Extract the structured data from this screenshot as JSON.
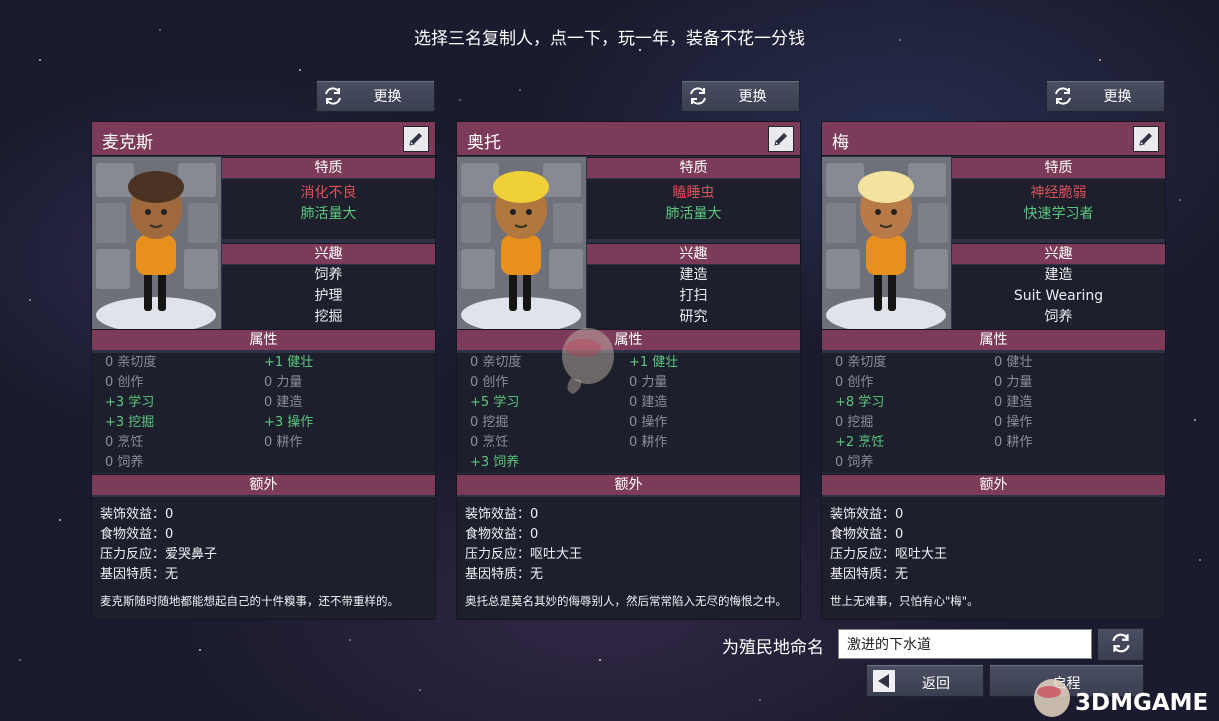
{
  "header": {
    "title": "选择三名复制人，点一下，玩一年，装备不花一分钱"
  },
  "reroll_label": "更换",
  "section_labels": {
    "traits": "特质",
    "interests": "兴趣",
    "attributes": "属性",
    "extra": "额外"
  },
  "cards": [
    {
      "name": "麦克斯",
      "traits": [
        {
          "text": "消化不良",
          "kind": "bad"
        },
        {
          "text": "肺活量大",
          "kind": "good"
        }
      ],
      "interests": [
        "饲养",
        "护理",
        "挖掘"
      ],
      "attributes": {
        "left": [
          {
            "text": "0 亲切度",
            "kind": "zero"
          },
          {
            "text": "0 创作",
            "kind": "zero"
          },
          {
            "text": "+3 学习",
            "kind": "pos"
          },
          {
            "text": "+3 挖掘",
            "kind": "pos"
          },
          {
            "text": "0 烹饪",
            "kind": "zero"
          },
          {
            "text": "0 饲养",
            "kind": "zero"
          }
        ],
        "right": [
          {
            "text": "+1 健壮",
            "kind": "pos"
          },
          {
            "text": "0 力量",
            "kind": "zero"
          },
          {
            "text": "0 建造",
            "kind": "zero"
          },
          {
            "text": "+3 操作",
            "kind": "pos"
          },
          {
            "text": "0 耕作",
            "kind": "zero"
          }
        ]
      },
      "extra": {
        "decor": "装饰效益：0",
        "food": "食物效益：0",
        "stress": "压力反应：爱哭鼻子",
        "gene": "基因特质：无"
      },
      "bio": "麦克斯随时随地都能想起自己的十件糗事，还不带重样的。",
      "hair_color": "#4a3322",
      "skin_color": "#a06a3e",
      "suit_color": "#e8901e"
    },
    {
      "name": "奥托",
      "traits": [
        {
          "text": "瞌睡虫",
          "kind": "bad"
        },
        {
          "text": "肺活量大",
          "kind": "good"
        }
      ],
      "interests": [
        "建造",
        "打扫",
        "研究"
      ],
      "attributes": {
        "left": [
          {
            "text": "0 亲切度",
            "kind": "zero"
          },
          {
            "text": "0 创作",
            "kind": "zero"
          },
          {
            "text": "+5 学习",
            "kind": "pos"
          },
          {
            "text": "0 挖掘",
            "kind": "zero"
          },
          {
            "text": "0 烹饪",
            "kind": "zero"
          },
          {
            "text": "+3 饲养",
            "kind": "pos"
          }
        ],
        "right": [
          {
            "text": "+1 健壮",
            "kind": "pos"
          },
          {
            "text": "0 力量",
            "kind": "zero"
          },
          {
            "text": "0 建造",
            "kind": "zero"
          },
          {
            "text": "0 操作",
            "kind": "zero"
          },
          {
            "text": "0 耕作",
            "kind": "zero"
          }
        ]
      },
      "extra": {
        "decor": "装饰效益：0",
        "food": "食物效益：0",
        "stress": "压力反应：呕吐大王",
        "gene": "基因特质：无"
      },
      "bio": "奥托总是莫名其妙的侮辱别人，然后常常陷入无尽的悔恨之中。",
      "hair_color": "#f0d038",
      "skin_color": "#b0783e",
      "suit_color": "#e8901e"
    },
    {
      "name": "梅",
      "traits": [
        {
          "text": "神经脆弱",
          "kind": "bad"
        },
        {
          "text": "快速学习者",
          "kind": "good"
        }
      ],
      "interests": [
        "建造",
        "Suit Wearing",
        "饲养"
      ],
      "attributes": {
        "left": [
          {
            "text": "0 亲切度",
            "kind": "zero"
          },
          {
            "text": "0 创作",
            "kind": "zero"
          },
          {
            "text": "+8 学习",
            "kind": "pos"
          },
          {
            "text": "0 挖掘",
            "kind": "zero"
          },
          {
            "text": "+2 烹饪",
            "kind": "pos"
          },
          {
            "text": "0 饲养",
            "kind": "zero"
          }
        ],
        "right": [
          {
            "text": "0 健壮",
            "kind": "zero"
          },
          {
            "text": "0 力量",
            "kind": "zero"
          },
          {
            "text": "0 建造",
            "kind": "zero"
          },
          {
            "text": "0 操作",
            "kind": "zero"
          },
          {
            "text": "0 耕作",
            "kind": "zero"
          }
        ]
      },
      "extra": {
        "decor": "装饰效益：0",
        "food": "食物效益：0",
        "stress": "压力反应：呕吐大王",
        "gene": "基因特质：无"
      },
      "bio": "世上无难事，只怕有心\"梅\"。",
      "hair_color": "#f2e4a0",
      "skin_color": "#b87a48",
      "suit_color": "#e8901e"
    }
  ],
  "colony": {
    "label": "为殖民地命名",
    "name": "激进的下水道"
  },
  "nav": {
    "back": "返回",
    "embark": "启程"
  },
  "watermark": "3DMGAME",
  "colors": {
    "accent": "#7d3b5a",
    "panel": "#2e3248",
    "bad": "#e0505a",
    "good": "#5cc77e"
  }
}
